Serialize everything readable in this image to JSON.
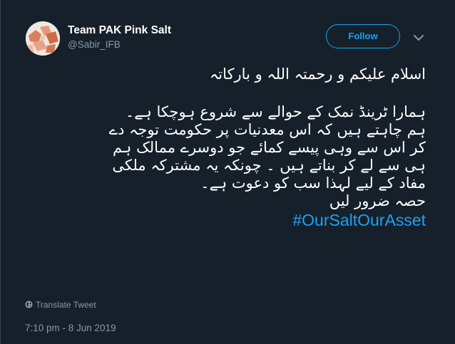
{
  "tweet": {
    "author_name": "Team PAK Pink Salt",
    "author_handle": "@Sabir_IFB",
    "avatar_icon": "pink-salt-rocks-avatar",
    "follow_label": "Follow",
    "menu_icon": "chevron-down-icon",
    "greeting": "اسلام علیکم و رحمتہ اللہ و بارکاتہ",
    "paragraph": "ہمارا ٹرینڈ نمک کے حوالے سے شروع ہوچکا ہے۔ ہم چاہتے ہیں کہ اس معدنیات پر حکومت توجہ دے کر اس سے وہی پیسے کمائے جو دوسرے ممالک ہم ہی سے لے کر بناتے ہیں ۔ چونکہ یہ مشترکہ ملکی مفاد کے لیے لہذا سب کو دعوت ہے۔",
    "closing": "حصہ ضرور لیں",
    "hashtag": "#OurSaltOurAsset",
    "translate_label": "Translate Tweet",
    "translate_icon": "globe-icon",
    "timestamp": "7:10 pm - 8 Jun 2019"
  },
  "colors": {
    "background": "#15202b",
    "text": "#ffffff",
    "secondary_text": "#8899a6",
    "accent": "#1da1f2"
  }
}
